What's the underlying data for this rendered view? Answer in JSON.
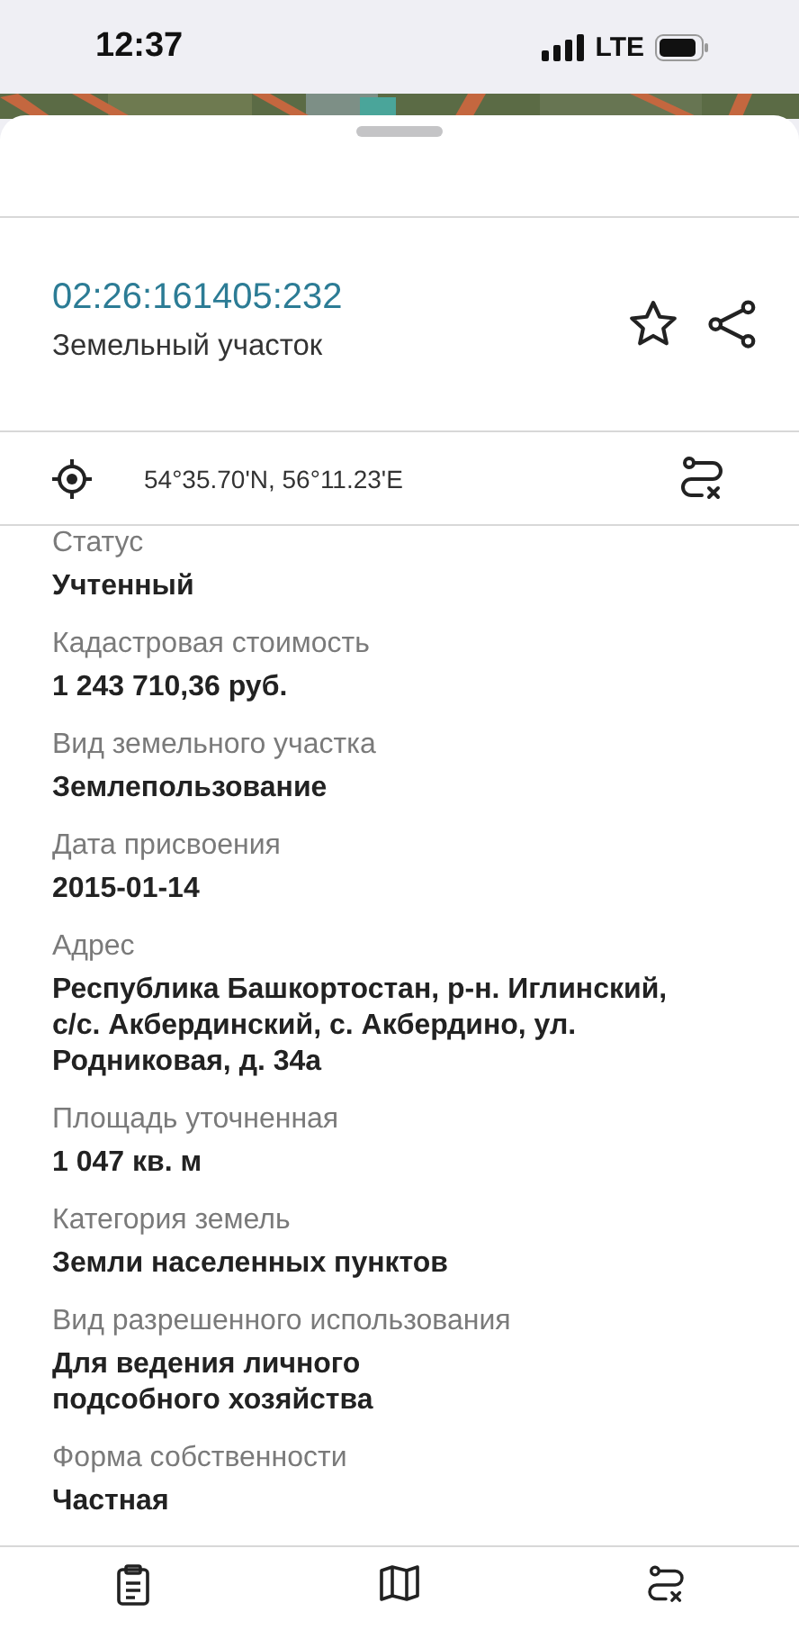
{
  "status_bar": {
    "time": "12:37",
    "network": "LTE"
  },
  "object": {
    "number": "02:26:161405:232",
    "type": "Земельный участок",
    "favorite": false
  },
  "coordinates": "54°35.70'N, 56°11.23'E",
  "fields": [
    {
      "label": "Статус",
      "value": "Учтенный"
    },
    {
      "label": "Кадастровая стоимость",
      "value": "1 243 710,36 руб."
    },
    {
      "label": "Вид земельного участка",
      "value": "Землепользование"
    },
    {
      "label": "Дата присвоения",
      "value": "2015-01-14"
    },
    {
      "label": "Адрес",
      "value": "Республика Башкортостан, р-н. Иглинский,\nс/с. Акбердинский, с. Акбердино, ул.\nРодниковая, д. 34а"
    },
    {
      "label": "Площадь уточненная",
      "value": "1 047 кв. м"
    },
    {
      "label": "Категория земель",
      "value": "Земли населенных пунктов"
    },
    {
      "label": "Вид разрешенного использования",
      "value": "Для ведения личного\nподсобного хозяйства"
    },
    {
      "label": "Форма собственности",
      "value": "Частная"
    }
  ],
  "bottom_tabs": [
    {
      "kind": "info"
    },
    {
      "kind": "map"
    },
    {
      "kind": "route"
    }
  ]
}
